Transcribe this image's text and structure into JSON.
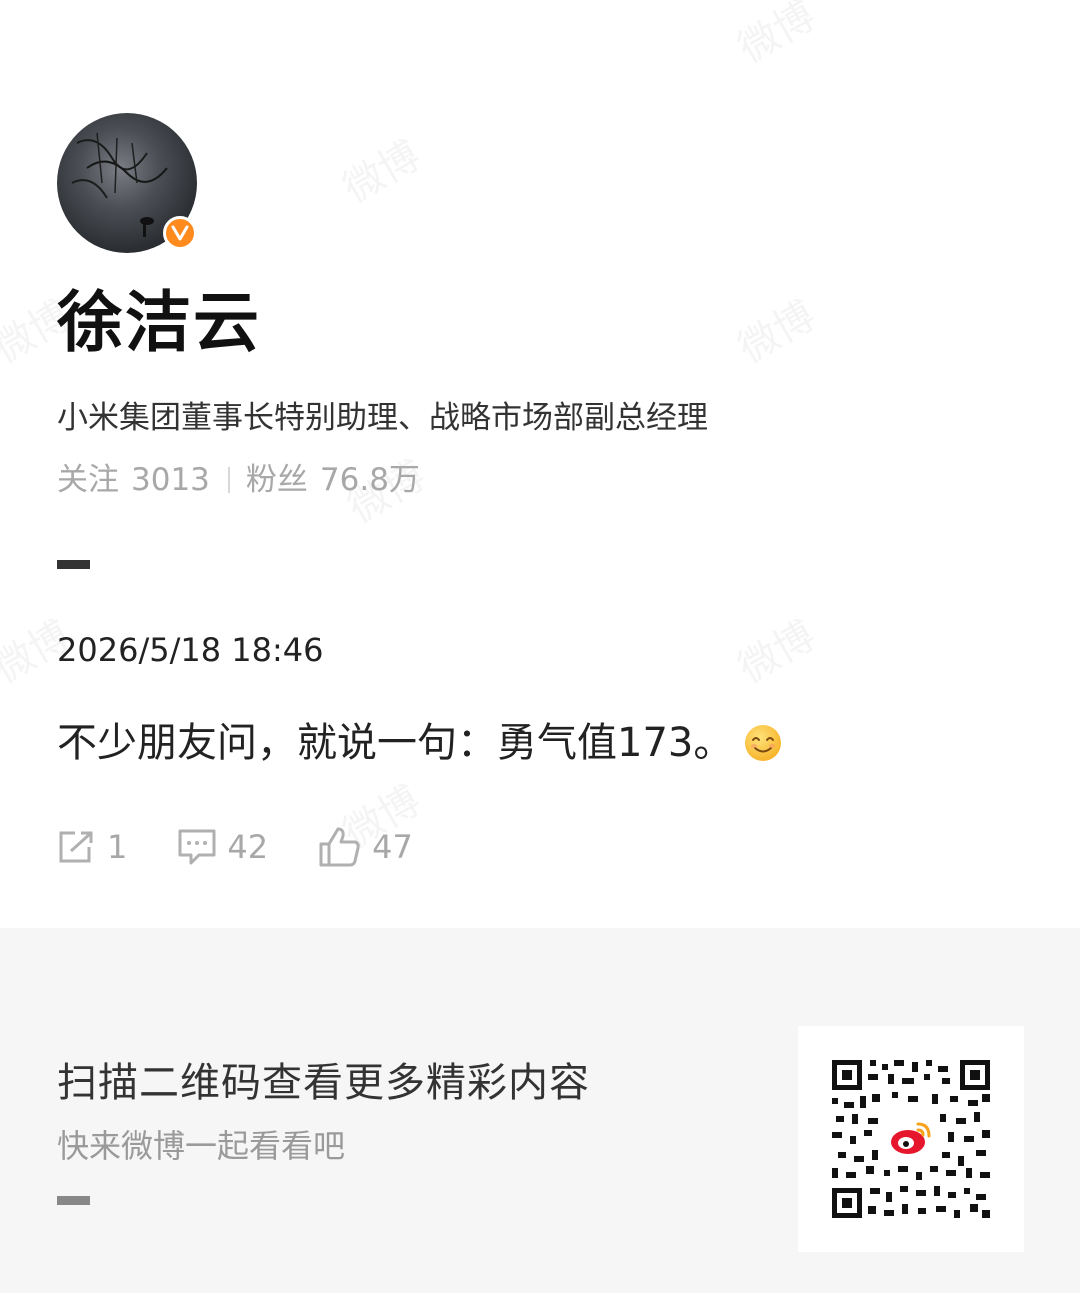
{
  "watermark": {
    "text": "微博"
  },
  "profile": {
    "name": "徐洁云",
    "bio": "小米集团董事长特别助理、战略市场部副总经理",
    "following_label": "关注",
    "following_count": "3013",
    "followers_label": "粉丝",
    "followers_count": "76.8万"
  },
  "post": {
    "timestamp": "2026/5/18 18:46",
    "text": "不少朋友问，就说一句：勇气值173。",
    "emoji": "smile-emoji",
    "reposts": "1",
    "comments": "42",
    "likes": "47"
  },
  "footer": {
    "title": "扫描二维码查看更多精彩内容",
    "subtitle": "快来微博一起看看吧"
  },
  "colors": {
    "verified_badge": "#ff8a1e",
    "footer_bg": "#f6f6f6",
    "muted_text": "#a8a8a8"
  }
}
